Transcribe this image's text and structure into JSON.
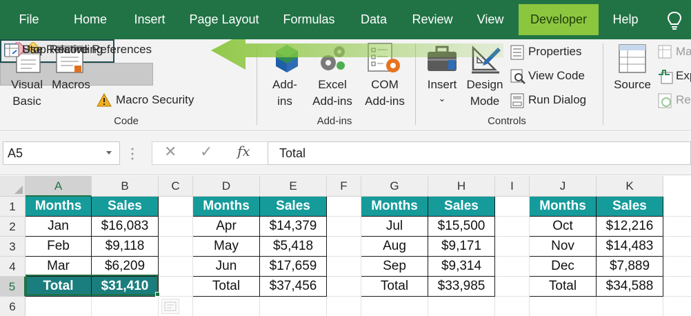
{
  "tabs": [
    {
      "label": "File"
    },
    {
      "label": "Home"
    },
    {
      "label": "Insert"
    },
    {
      "label": "Page Layout"
    },
    {
      "label": "Formulas"
    },
    {
      "label": "Data"
    },
    {
      "label": "Review"
    },
    {
      "label": "View"
    },
    {
      "label": "Developer",
      "active": true
    },
    {
      "label": "Help"
    }
  ],
  "help_icon": "lightbulb-icon",
  "ribbon": {
    "code": {
      "visual_basic": [
        "Visual",
        "Basic"
      ],
      "macros": "Macros",
      "stop_recording": "Stop Recording",
      "use_relative": "Use Relative References",
      "macro_security": "Macro Security",
      "group_label": "Code"
    },
    "addins": {
      "addins": [
        "Add-",
        "ins"
      ],
      "excel_addins": [
        "Excel",
        "Add-ins"
      ],
      "com_addins": [
        "COM",
        "Add-ins"
      ],
      "group_label": "Add-ins"
    },
    "controls": {
      "insert": "Insert",
      "insert_caret": "⌄",
      "design_mode": [
        "Design",
        "Mode"
      ],
      "properties": "Properties",
      "view_code": "View Code",
      "run_dialog": "Run Dialog",
      "group_label": "Controls"
    },
    "xml": {
      "source": "Source",
      "map_properties": "Ma",
      "export": "Exp",
      "refresh": "Re"
    }
  },
  "annotation_arrow_color": "#8cc63f",
  "formula_bar": {
    "name_box": "A5",
    "cancel_glyph": "✕",
    "enter_glyph": "✓",
    "fx_glyph": "fx",
    "content": "Total"
  },
  "sheet": {
    "columns": [
      "A",
      "B",
      "C",
      "D",
      "E",
      "F",
      "G",
      "H",
      "I",
      "J",
      "K"
    ],
    "selected_column": "A",
    "rows": [
      "1",
      "2",
      "3",
      "4",
      "5",
      "6"
    ],
    "selected_row": "5",
    "header_color": "#169b9b",
    "tables": [
      {
        "headers": [
          "Months",
          "Sales"
        ],
        "rows": [
          [
            "Jan",
            "$16,083"
          ],
          [
            "Feb",
            "$9,118"
          ],
          [
            "Mar",
            "$6,209"
          ]
        ],
        "total": [
          "Total",
          "$31,410"
        ]
      },
      {
        "headers": [
          "Months",
          "Sales"
        ],
        "rows": [
          [
            "Apr",
            "$14,379"
          ],
          [
            "May",
            "$5,418"
          ],
          [
            "Jun",
            "$17,659"
          ]
        ],
        "total": [
          "Total",
          "$37,456"
        ]
      },
      {
        "headers": [
          "Months",
          "Sales"
        ],
        "rows": [
          [
            "Jul",
            "$15,500"
          ],
          [
            "Aug",
            "$9,171"
          ],
          [
            "Sep",
            "$9,314"
          ]
        ],
        "total": [
          "Total",
          "$33,985"
        ]
      },
      {
        "headers": [
          "Months",
          "Sales"
        ],
        "rows": [
          [
            "Oct",
            "$12,216"
          ],
          [
            "Nov",
            "$14,483"
          ],
          [
            "Dec",
            "$7,889"
          ]
        ],
        "total": [
          "Total",
          "$34,588"
        ]
      }
    ]
  }
}
